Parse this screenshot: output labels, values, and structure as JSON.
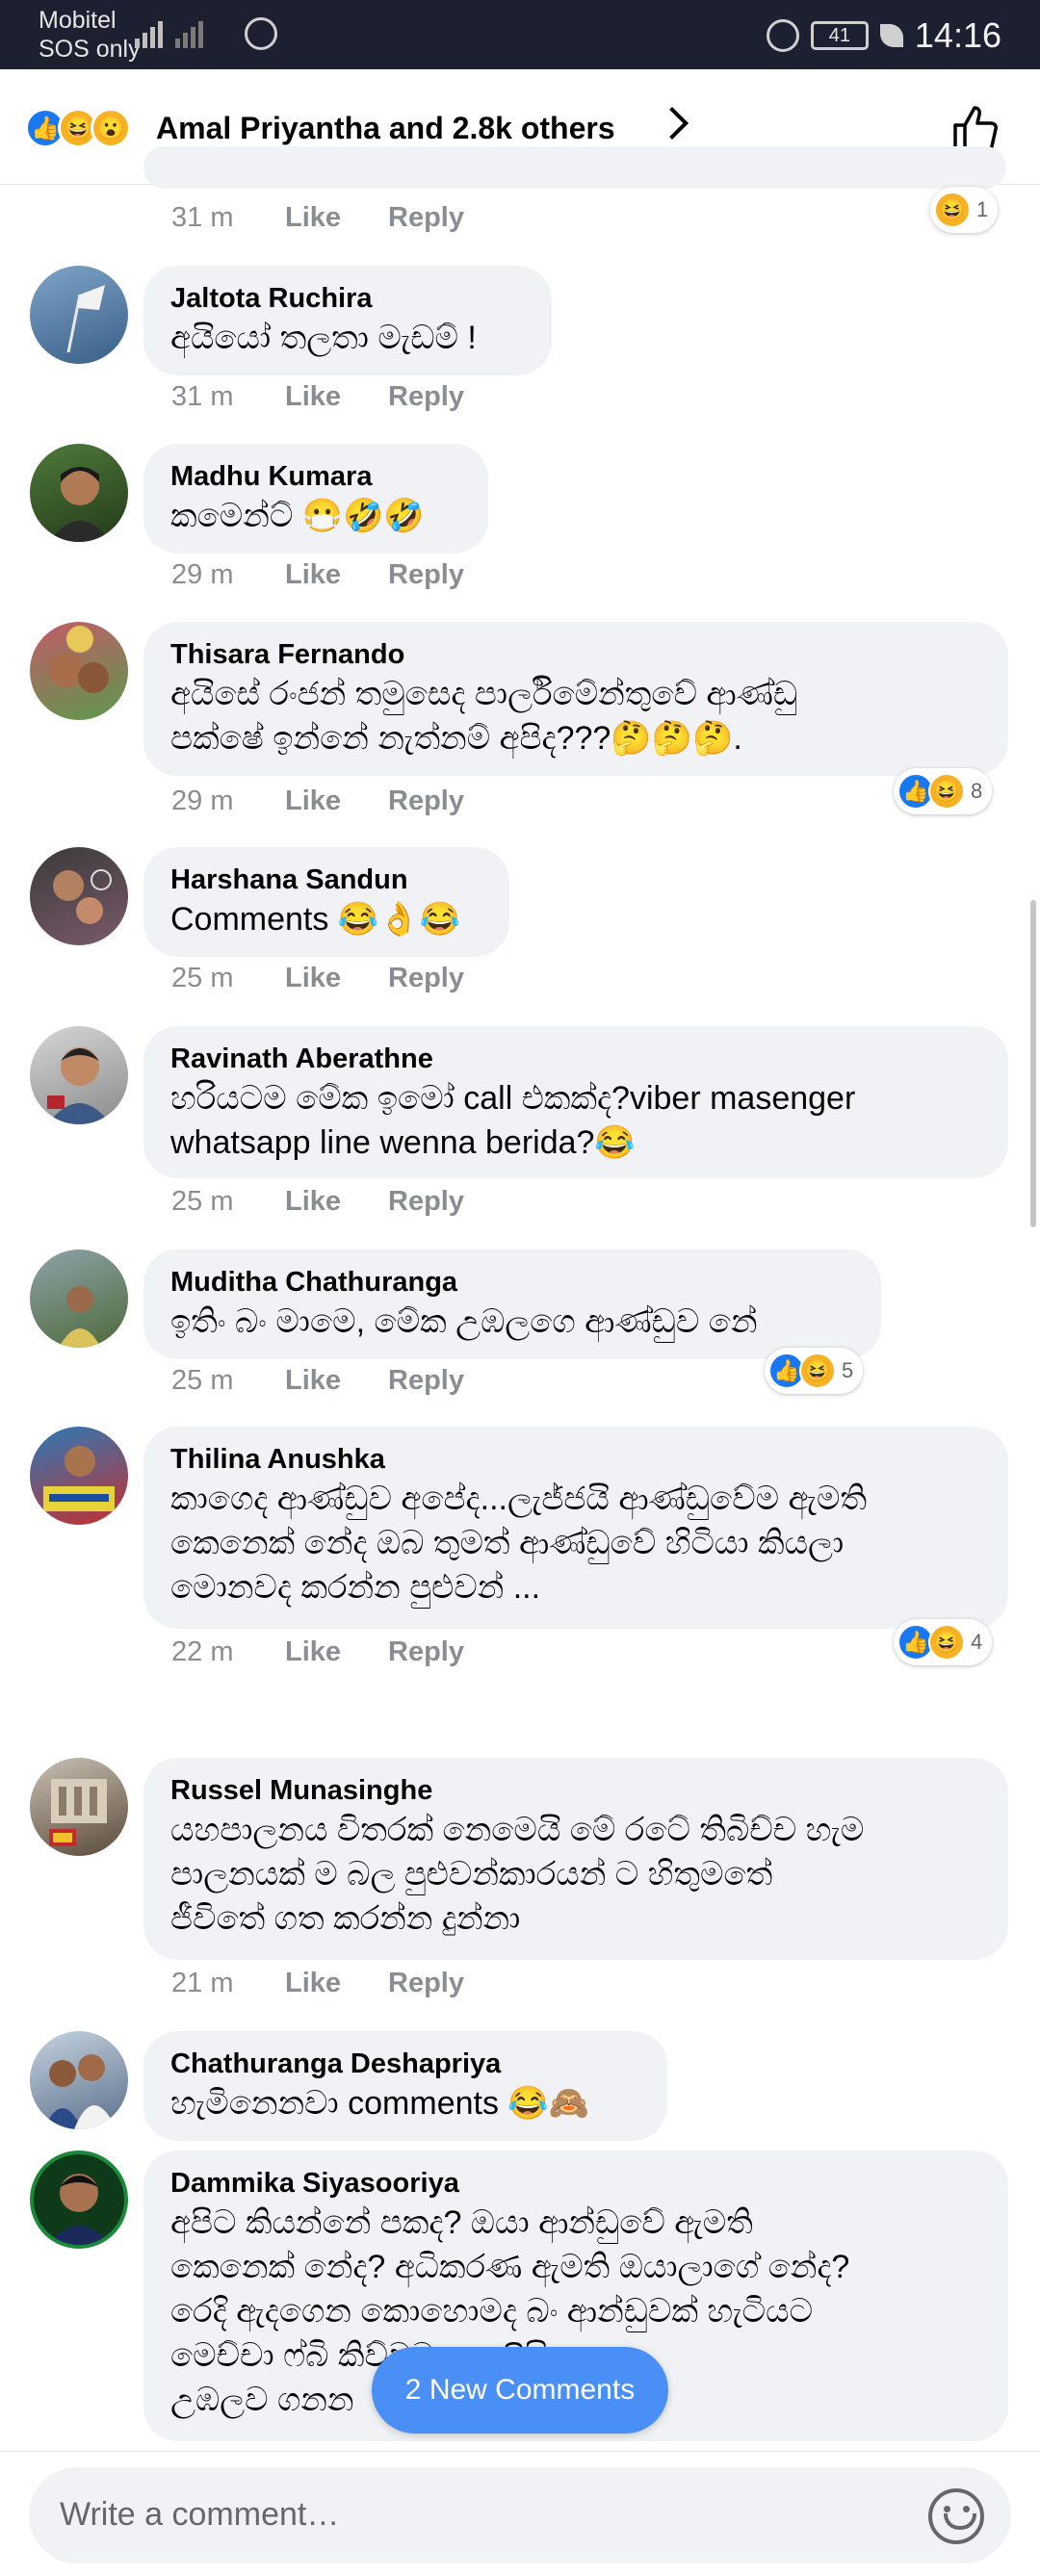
{
  "status_bar": {
    "carrier": "Mobitel",
    "carrier_sub": "SOS only",
    "battery": "41",
    "time": "14:16"
  },
  "header": {
    "reactions_summary": "Amal Priyantha and 2.8k others",
    "reaction_icons": [
      "like-icon",
      "haha-icon",
      "wow-icon"
    ]
  },
  "actions": {
    "like": "Like",
    "reply": "Reply"
  },
  "comments": [
    {
      "author": "",
      "text": "",
      "time": "31 m",
      "reaction_count": "1"
    },
    {
      "author": "Jaltota Ruchira",
      "text": "අයියෝ තලතා මැඩම් !",
      "time": "31 m"
    },
    {
      "author": "Madhu Kumara",
      "text": "කමෙන්ට් 😷🤣🤣",
      "time": "29 m"
    },
    {
      "author": "Thisara Fernando",
      "text": "අයිසේ රංජන් තමුසෙද පාර්ලිමේන්තුවේ ආණ්ඩු\nපක්ෂේ ඉන්නේ නැත්නම් අපිද???🤔🤔🤔.",
      "time": "29 m",
      "reaction_count": "8"
    },
    {
      "author": "Harshana Sandun",
      "text": "Comments 😂👌😂",
      "time": "25 m"
    },
    {
      "author": "Ravinath Aberathne",
      "text": "හරියටම මේක ඉමෝ call එකක්ද?viber masenger\nwhatsapp line wenna berida?😂",
      "time": "25 m"
    },
    {
      "author": "Muditha Chathuranga",
      "text": "ඉතිං බං මාමෙ, මේක උඹලගෙ ආණ්ඩුව නේ",
      "time": "25 m",
      "reaction_count": "5"
    },
    {
      "author": "Thilina Anushka",
      "text": "කාගෙද ආණ්ඩුව අපේද...ලැජ්ජයි ආණ්ඩුවේම ඇමති\nකෙනෙක් නේද ඔබ තුමත් ආණ්ඩුවේ හිටියා කියලා\nමොනවද කරන්න පුළුවන් ...",
      "time": "22 m",
      "reaction_count": "4"
    },
    {
      "author": "Russel Munasinghe",
      "text": "යහපාලනය විතරක් නෙමෙයි මේ රටේ තිබිච්ච හැම\nපාලනයක් ම බල පුළුවන්කාරයන් ට හිතුමතේ\nජීවිතේ ගත කරන්න දුන්නා",
      "time": "21 m"
    },
    {
      "author": "Chathuranga Deshapriya",
      "text": "හැමිනෙනවා comments 😂🙈",
      "time": ""
    },
    {
      "author": "Dammika Siyasooriya",
      "text": "අපිට කියන්නේ පකද? ඔයා ආන්ඩුවේ ඇමති\nකෙනෙක් නේද? අධිකරණ ඇමති ඔයාලාගේ නේද?\nරෙදි ඇදගෙන කොහොමද බං ආන්ඩුවක් හැටියට\nමෙච්චා ෆ්බි                          කිව්වට පොලිසිය\nඋඹලව ගනන",
      "time": ""
    }
  ],
  "new_comments_label": "2 New Comments",
  "composer": {
    "placeholder": "Write a comment…"
  },
  "colors": {
    "accent": "#1877f2",
    "bubble": "#f0f2f5",
    "new_comments": "#4a8ff5",
    "status_bar": "#1c2030"
  }
}
